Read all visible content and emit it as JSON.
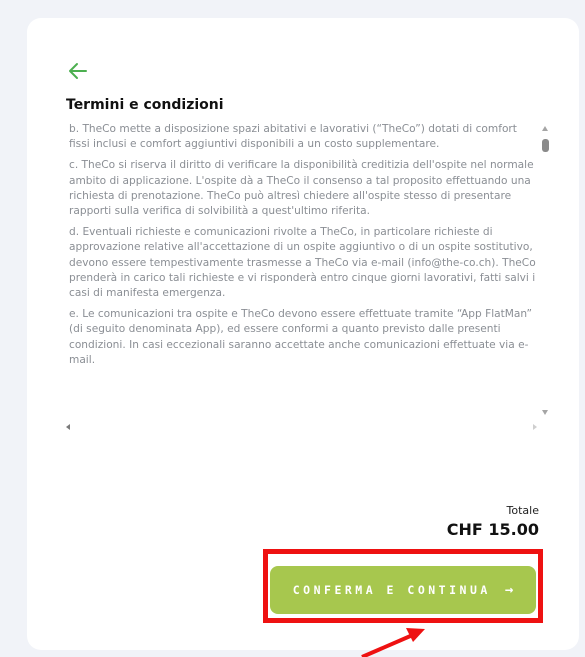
{
  "title": "Termini e condizioni",
  "back_icon": "arrow-left-icon",
  "terms": [
    "b. TheCo mette a disposizione spazi abitativi e lavorativi (“TheCo”) dotati di comfort fissi inclusi e comfort aggiuntivi disponibili a un costo supplementare.",
    "c. TheCo si riserva il diritto di verificare la disponibilità creditizia dell'ospite nel normale ambito di applicazione. L'ospite dà a TheCo il consenso a tal proposito effettuando una richiesta di prenotazione. TheCo può altresì chiedere all'ospite stesso di presentare rapporti sulla verifica di solvibilità a quest'ultimo riferita.",
    "d. Eventuali richieste e comunicazioni rivolte a TheCo, in particolare richieste di approvazione relative all'accettazione di un ospite aggiuntivo o di un ospite sostitutivo, devono essere tempestivamente trasmesse a TheCo via e-mail (info@the-co.ch). TheCo prenderà in carico tali richieste e vi risponderà entro cinque giorni lavorativi, fatti salvi i casi di manifesta emergenza.",
    "e. Le comunicazioni tra ospite e TheCo devono essere effettuate tramite “App FlatMan” (di seguito denominata App), ed essere conformi a quanto previsto dalle presenti condizioni. In casi eccezionali saranno accettate anche comunicazioni effettuate via e-mail."
  ],
  "total": {
    "label": "Totale",
    "value": "CHF 15.00"
  },
  "confirm_button": {
    "label": "CONFERMA E CONTINUA",
    "icon": "arrow-right-icon",
    "arrow": "→"
  },
  "colors": {
    "accent": "#a7c74e",
    "highlight": "#ee1111",
    "back_arrow": "#4caf50"
  }
}
